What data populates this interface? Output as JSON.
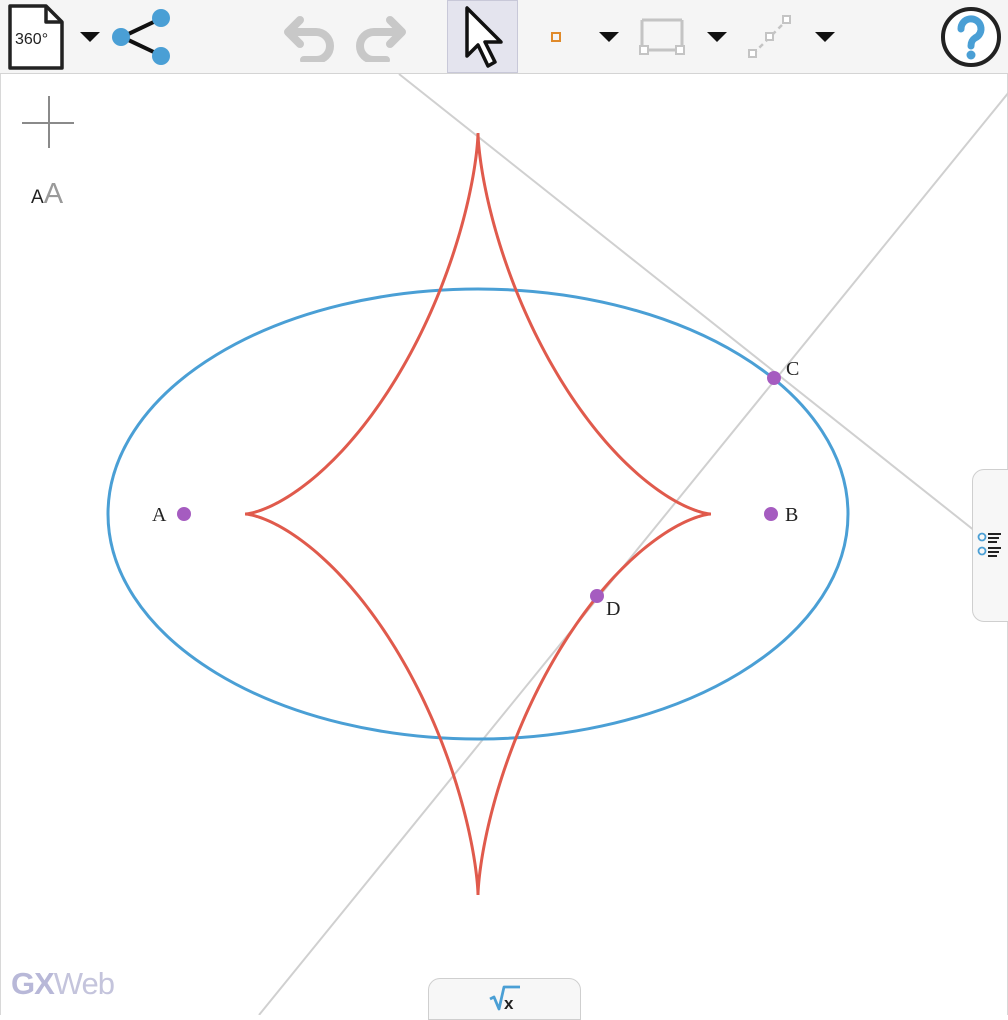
{
  "toolbar": {
    "file_label": "360°",
    "tools": [
      "file-menu",
      "share",
      "undo",
      "redo",
      "select",
      "point",
      "segment",
      "construct"
    ],
    "accent": "#4a9fd5"
  },
  "canvas": {
    "points": [
      {
        "label": "A",
        "color": "#a55cc0"
      },
      {
        "label": "B",
        "color": "#a55cc0"
      },
      {
        "label": "C",
        "color": "#a55cc0"
      },
      {
        "label": "D",
        "color": "#a55cc0"
      }
    ],
    "ellipse_color": "#4a9fd5",
    "astroid_color": "#e05a4c",
    "line_color": "#d0d0d0"
  },
  "text_size": {
    "small": "A",
    "large": "A"
  },
  "brand": {
    "gx": "GX",
    "web": "Web"
  },
  "bottom_tab": {
    "label": "√x"
  }
}
